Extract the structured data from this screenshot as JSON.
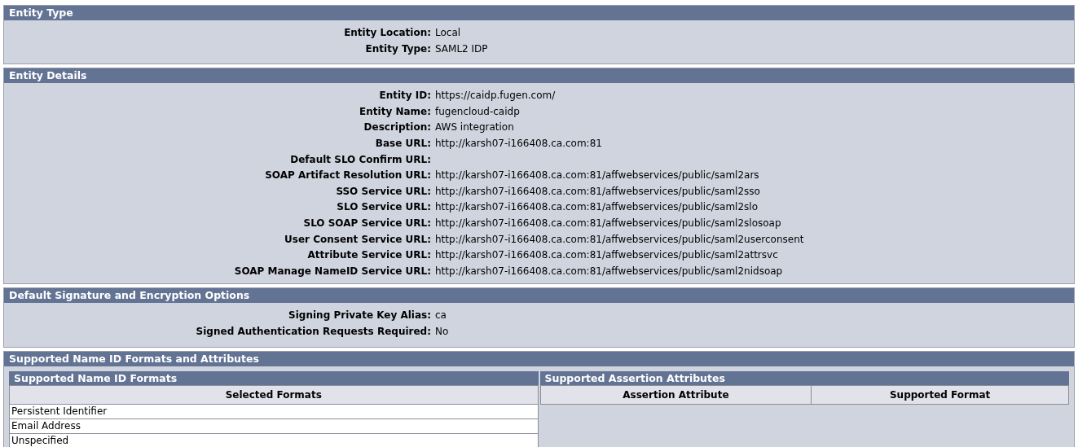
{
  "sections": [
    {
      "title": "Entity Type",
      "fields": [
        {
          "label": "Entity Location:",
          "value": "Local"
        },
        {
          "label": "Entity Type:",
          "value": "SAML2 IDP"
        }
      ]
    },
    {
      "title": "Entity Details",
      "fields": [
        {
          "label": "Entity ID:",
          "value": "https://caidp.fugen.com/"
        },
        {
          "label": "Entity Name:",
          "value": "fugencloud-caidp"
        },
        {
          "label": "Description:",
          "value": "AWS integration"
        },
        {
          "label": "Base URL:",
          "value": "http://karsh07-i166408.ca.com:81"
        },
        {
          "label": "Default SLO Confirm URL:"
        },
        {
          "label": "SOAP Artifact Resolution URL:",
          "value": "http://karsh07-i166408.ca.com:81/affwebservices/public/saml2ars"
        },
        {
          "label": "SSO Service URL:",
          "value": "http://karsh07-i166408.ca.com:81/affwebservices/public/saml2sso"
        },
        {
          "label": "SLO Service URL:",
          "value": "http://karsh07-i166408.ca.com:81/affwebservices/public/saml2slo"
        },
        {
          "label": "SLO SOAP Service URL:",
          "value": "http://karsh07-i166408.ca.com:81/affwebservices/public/saml2slosoap"
        },
        {
          "label": "User Consent Service URL:",
          "value": "http://karsh07-i166408.ca.com:81/affwebservices/public/saml2userconsent"
        },
        {
          "label": "Attribute Service URL:",
          "value": "http://karsh07-i166408.ca.com:81/affwebservices/public/saml2attrsvc"
        },
        {
          "label": "SOAP Manage NameID Service URL:",
          "value": "http://karsh07-i166408.ca.com:81/affwebservices/public/saml2nidsoap"
        }
      ]
    },
    {
      "title": "Default Signature and Encryption Options",
      "fields": [
        {
          "label": "Signing Private Key Alias:",
          "value": "ca"
        },
        {
          "label": "Signed Authentication Requests Required:",
          "value": "No"
        }
      ]
    }
  ],
  "formats_section": {
    "title": "Supported Name ID Formats and Attributes",
    "name_id_formats": {
      "title": "Supported Name ID Formats",
      "column": "Selected Formats",
      "rows": [
        "Persistent Identifier",
        "Email Address",
        "Unspecified"
      ]
    },
    "assertion_attributes": {
      "title": "Supported Assertion Attributes",
      "columns": [
        "Assertion Attribute",
        "Supported Format"
      ]
    }
  }
}
